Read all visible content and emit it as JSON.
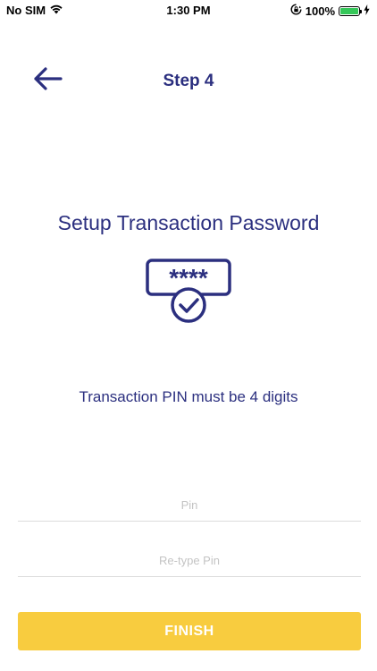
{
  "status_bar": {
    "carrier": "No SIM",
    "time": "1:30 PM",
    "battery": "100%",
    "battery_level": 1.0,
    "icons": [
      "wifi-icon",
      "orientation-lock-icon",
      "battery-icon",
      "charging-bolt-icon"
    ]
  },
  "header": {
    "title": "Step 4",
    "back_icon": "arrow-left-icon"
  },
  "main": {
    "title": "Setup Transaction Password",
    "illustration": "pin-check-icon",
    "illustration_text": "****",
    "hint": "Transaction PIN must be 4 digits"
  },
  "form": {
    "pin_placeholder": "Pin",
    "pin_value": "",
    "repin_placeholder": "Re-type Pin",
    "repin_value": ""
  },
  "actions": {
    "finish_label": "FINISH"
  },
  "colors": {
    "primary": "#2b2f7f",
    "accent": "#f8cc3f",
    "battery": "#35c759"
  }
}
